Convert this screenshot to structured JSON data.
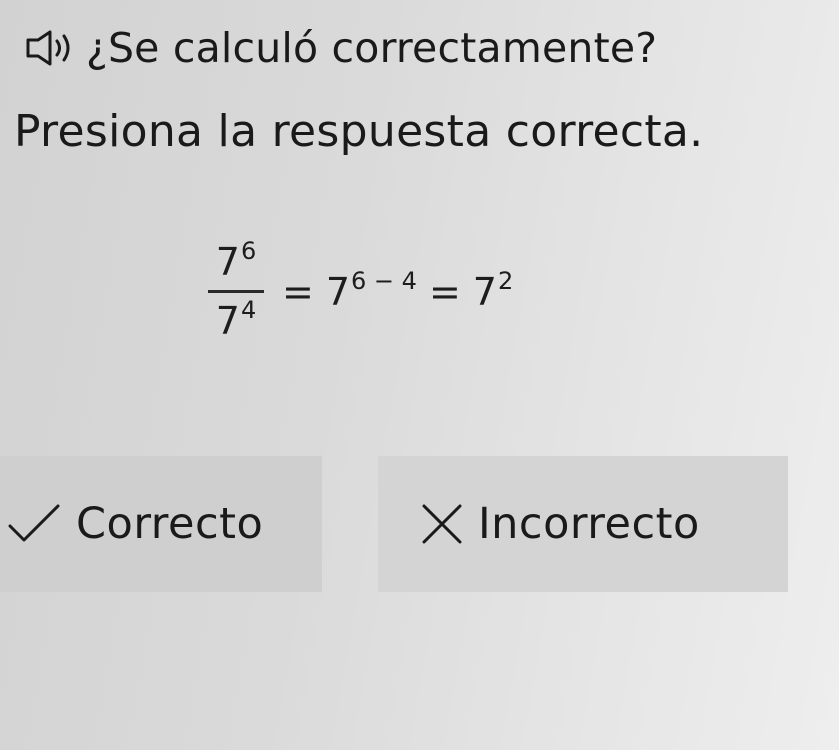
{
  "question": {
    "text": "¿Se calculó correctamente?",
    "audio_icon": "speaker-icon"
  },
  "instruction": "Presiona la respuesta correcta.",
  "equation": {
    "numerator_base": "7",
    "numerator_exp": "6",
    "denominator_base": "7",
    "denominator_exp": "4",
    "equals": "=",
    "middle_base": "7",
    "middle_exp": "6 − 4",
    "result_base": "7",
    "result_exp": "2"
  },
  "answers": {
    "correct_label": "Correcto",
    "correct_icon": "check-icon",
    "incorrect_label": "Incorrecto",
    "incorrect_icon": "x-icon"
  }
}
